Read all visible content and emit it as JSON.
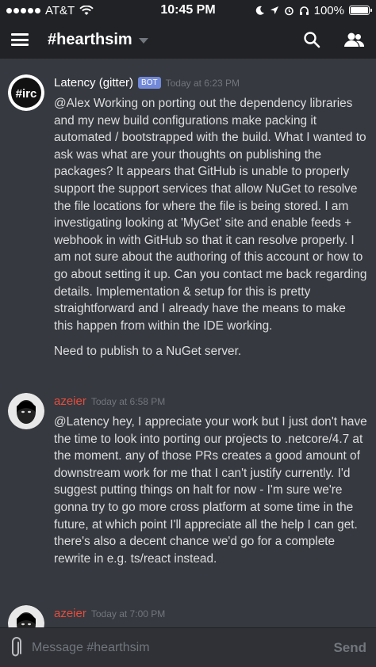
{
  "status": {
    "carrier": "AT&T",
    "time": "10:45 PM",
    "battery": "100%",
    "battery_level": 1.0
  },
  "header": {
    "channel": "#hearthsim"
  },
  "messages": [
    {
      "author": "Latency (gitter)",
      "badge": "BOT",
      "timestamp": "Today at 6:23 PM",
      "avatar_text": "#irc",
      "paragraphs": [
        "@Alex Working on porting out the dependency libraries and my new build configurations make packing it automated / bootstrapped with the build. What I wanted to ask was what are your thoughts on publishing the packages?  It appears that GitHub is unable to properly support the support services that allow NuGet to resolve the file locations for where the file is being stored.    I am investigating looking at 'MyGet' site and enable feeds + webhook in with GitHub so that it can resolve properly.    I am not sure about the authoring of this account or how to go about setting it up.  Can you contact me back regarding details.   Implementation & setup for this is pretty straightforward and I already have the means to make this happen from within the IDE working.",
        "Need to publish to a  NuGet server."
      ]
    },
    {
      "author": "azeier",
      "timestamp": "Today at 6:58 PM",
      "paragraphs": [
        "@Latency hey, I appreciate your work but I just don't have the time to look into porting our projects to .netcore/4.7 at the moment. any of those PRs creates a good amount of downstream work for me that I can't justify currently.  I'd suggest putting things on halt for now - I'm sure we're gonna try to go more cross platform at some time in the future, at which point I'll appreciate all the help I can get. there's also a decent chance we'd go for a complete rewrite in e.g. ts/react instead."
      ]
    },
    {
      "author": "azeier",
      "timestamp": "Today at 7:00 PM"
    }
  ],
  "composer": {
    "placeholder": "Message #hearthsim",
    "send_label": "Send"
  },
  "colors": {
    "background": "#36393f",
    "header": "#202225",
    "bot_badge": "#7289da",
    "azeier_name": "#e74c3c"
  }
}
